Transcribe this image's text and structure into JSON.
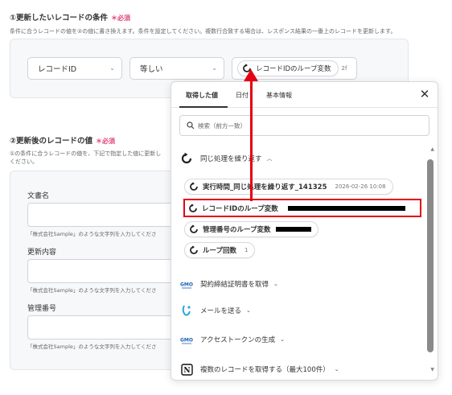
{
  "section1": {
    "title": "①更新したいレコードの条件",
    "required": "＊必須",
    "description": "条件に合うレコードの値を②の値に書き換えます。条件を設定してください。複数行合致する場合は、レスポンス結果の一番上のレコードを更新します。",
    "field_select": "レコードID",
    "operator_select": "等しい",
    "value_chip": "レコードIDのループ変数",
    "value_suffix": "2f"
  },
  "section2": {
    "title": "②更新後のレコードの値",
    "required": "＊必須",
    "description_line1": "①の条件に合うレコードの値を、下記で指定した値に更新し",
    "description_line2": "ください。",
    "fields": [
      {
        "label": "文書名",
        "hint": "「株式会社Sample」のような文字列を入力してくださ"
      },
      {
        "label": "更新内容",
        "hint": "「株式会社Sample」のような文字列を入力してくださ"
      },
      {
        "label": "管理番号",
        "hint": "「株式会社Sample」のような文字列を入力してくださ"
      }
    ]
  },
  "popup": {
    "tabs": [
      "取得した値",
      "日付",
      "基本情報"
    ],
    "search_placeholder": "検索（前方一致）",
    "group_open": "同じ処理を繰り返す",
    "items": [
      {
        "label": "実行時間_同じ処理を繰り返す_141325",
        "value": "2026-02-26 10:08"
      },
      {
        "label": "レコードIDのループ変数",
        "value": ""
      },
      {
        "label": "管理番号のループ変数",
        "value": ""
      },
      {
        "label": "ループ回数",
        "value": "1"
      }
    ],
    "groups": [
      "契約締結証明書を取得",
      "メールを送る",
      "アクセストークンの生成",
      "複数のレコードを取得する（最大100件）"
    ]
  },
  "colors": {
    "accent_red": "#e60012",
    "required_pink": "#e0457b"
  }
}
